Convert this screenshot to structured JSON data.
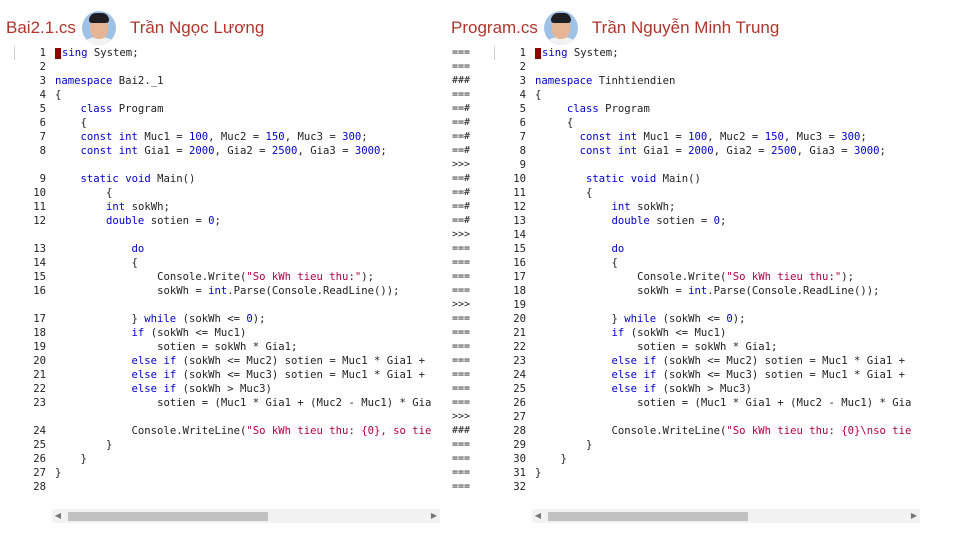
{
  "left": {
    "file_name": "Bai2.1.cs",
    "author": "Trần Ngọc Lương",
    "lines": [
      {
        "n": "1",
        "code": "using System;"
      },
      {
        "n": "2",
        "code": ""
      },
      {
        "n": "3",
        "code": "namespace Bai2._1"
      },
      {
        "n": "4",
        "code": "{"
      },
      {
        "n": "5",
        "code": "    class Program"
      },
      {
        "n": "6",
        "code": "    {"
      },
      {
        "n": "7",
        "code": "    const int Muc1 = 100, Muc2 = 150, Muc3 = 300;"
      },
      {
        "n": "8",
        "code": "    const int Gia1 = 2000, Gia2 = 2500, Gia3 = 3000;"
      },
      {
        "n": "",
        "code": ""
      },
      {
        "n": "9",
        "code": "    static void Main()"
      },
      {
        "n": "10",
        "code": "        {"
      },
      {
        "n": "11",
        "code": "        int sokWh;"
      },
      {
        "n": "12",
        "code": "        double sotien = 0;"
      },
      {
        "n": "",
        "code": ""
      },
      {
        "n": "13",
        "code": "            do"
      },
      {
        "n": "14",
        "code": "            {"
      },
      {
        "n": "15",
        "code": "                Console.Write(\"So kWh tieu thu:\");"
      },
      {
        "n": "16",
        "code": "                sokWh = int.Parse(Console.ReadLine());"
      },
      {
        "n": "",
        "code": ""
      },
      {
        "n": "17",
        "code": "            } while (sokWh <= 0);"
      },
      {
        "n": "18",
        "code": "            if (sokWh <= Muc1)"
      },
      {
        "n": "19",
        "code": "                sotien = sokWh * Gia1;"
      },
      {
        "n": "20",
        "code": "            else if (sokWh <= Muc2) sotien = Muc1 * Gia1 +"
      },
      {
        "n": "21",
        "code": "            else if (sokWh <= Muc3) sotien = Muc1 * Gia1 +"
      },
      {
        "n": "22",
        "code": "            else if (sokWh > Muc3)"
      },
      {
        "n": "23",
        "code": "                sotien = (Muc1 * Gia1 + (Muc2 - Muc1) * Gia"
      },
      {
        "n": "",
        "code": ""
      },
      {
        "n": "24",
        "code": "            Console.WriteLine(\"So kWh tieu thu: {0}, so tie"
      },
      {
        "n": "25",
        "code": "        }"
      },
      {
        "n": "26",
        "code": "    }"
      },
      {
        "n": "27",
        "code": "}"
      },
      {
        "n": "28",
        "code": ""
      }
    ]
  },
  "right": {
    "file_name": "Program.cs",
    "author": "Trần Nguyễn Minh Trung",
    "lines": [
      {
        "n": "1",
        "code": "using System;"
      },
      {
        "n": "2",
        "code": ""
      },
      {
        "n": "3",
        "code": "namespace Tinhtiendien"
      },
      {
        "n": "4",
        "code": "{"
      },
      {
        "n": "5",
        "code": "     class Program"
      },
      {
        "n": "6",
        "code": "     {"
      },
      {
        "n": "7",
        "code": "       const int Muc1 = 100, Muc2 = 150, Muc3 = 300;"
      },
      {
        "n": "8",
        "code": "       const int Gia1 = 2000, Gia2 = 2500, Gia3 = 3000;"
      },
      {
        "n": "9",
        "code": ""
      },
      {
        "n": "10",
        "code": "        static void Main()"
      },
      {
        "n": "11",
        "code": "        {"
      },
      {
        "n": "12",
        "code": "            int sokWh;"
      },
      {
        "n": "13",
        "code": "            double sotien = 0;"
      },
      {
        "n": "14",
        "code": ""
      },
      {
        "n": "15",
        "code": "            do"
      },
      {
        "n": "16",
        "code": "            {"
      },
      {
        "n": "17",
        "code": "                Console.Write(\"So kWh tieu thu:\");"
      },
      {
        "n": "18",
        "code": "                sokWh = int.Parse(Console.ReadLine());"
      },
      {
        "n": "19",
        "code": ""
      },
      {
        "n": "20",
        "code": "            } while (sokWh <= 0);"
      },
      {
        "n": "21",
        "code": "            if (sokWh <= Muc1)"
      },
      {
        "n": "22",
        "code": "                sotien = sokWh * Gia1;"
      },
      {
        "n": "23",
        "code": "            else if (sokWh <= Muc2) sotien = Muc1 * Gia1 +"
      },
      {
        "n": "24",
        "code": "            else if (sokWh <= Muc3) sotien = Muc1 * Gia1 +"
      },
      {
        "n": "25",
        "code": "            else if (sokWh > Muc3)"
      },
      {
        "n": "26",
        "code": "                sotien = (Muc1 * Gia1 + (Muc2 - Muc1) * Gia"
      },
      {
        "n": "27",
        "code": ""
      },
      {
        "n": "28",
        "code": "            Console.WriteLine(\"So kWh tieu thu: {0}\\nso tie"
      },
      {
        "n": "29",
        "code": "        }"
      },
      {
        "n": "30",
        "code": "    }"
      },
      {
        "n": "31",
        "code": "}"
      },
      {
        "n": "32",
        "code": ""
      }
    ]
  },
  "diff_markers": [
    "===",
    "===",
    "###",
    "===",
    "==#",
    "==#",
    "==#",
    "==#",
    ">>>",
    "==#",
    "==#",
    "==#",
    "==#",
    ">>>",
    "===",
    "===",
    "===",
    "===",
    ">>>",
    "===",
    "===",
    "===",
    "===",
    "===",
    "===",
    "===",
    ">>>",
    "###",
    "===",
    "===",
    "===",
    "==="
  ],
  "colors": {
    "header_text": "#b0352b",
    "cursor": "#8b0000",
    "keyword": "#0000cc",
    "string": "#b00040"
  },
  "icons": {
    "avatar": "avatar-photo",
    "scroll_left": "scroll-left-arrow-icon",
    "scroll_right": "scroll-right-arrow-icon"
  }
}
